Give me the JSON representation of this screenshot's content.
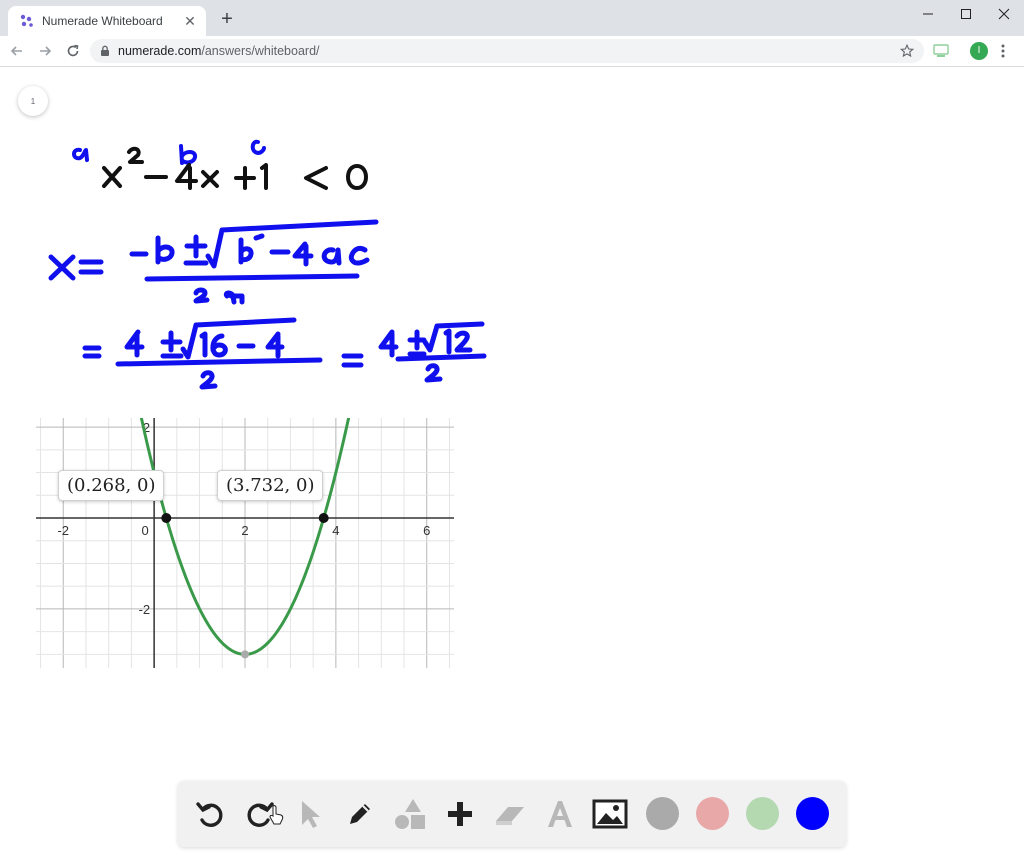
{
  "browser": {
    "tab_title": "Numerade Whiteboard",
    "url_host": "numerade.com",
    "url_path": "/answers/whiteboard/",
    "profile_initial": "I"
  },
  "whiteboard": {
    "page_number": "1"
  },
  "chart_data": {
    "type": "line",
    "series": [
      {
        "equation": "y = x^2 - 4x + 1"
      }
    ],
    "xlim": [
      -2.6,
      6.6
    ],
    "ylim": [
      -3.3,
      2.2
    ],
    "x_ticks": [
      "-2",
      "0",
      "2",
      "4",
      "6"
    ],
    "y_ticks": [
      "2",
      "-2"
    ],
    "grid": true,
    "points": [
      {
        "x": 0.268,
        "y": 0,
        "label": "(0.268, 0)"
      },
      {
        "x": 3.732,
        "y": 0,
        "label": "(3.732, 0)"
      },
      {
        "x": 2,
        "y": -3
      }
    ]
  },
  "colors": {
    "curve": "#3b9a4a",
    "ink_blue": "#1010ee",
    "ink_black": "#111111",
    "swatch_gray": "#aaaaaa",
    "swatch_pink": "#e8a8a8",
    "swatch_green": "#b4d8b0",
    "swatch_blue": "#0000ff"
  },
  "toolbar": {
    "tools": [
      "undo-icon",
      "redo-icon",
      "select-icon",
      "pen-icon",
      "shapes-icon",
      "add-icon",
      "eraser-icon",
      "text-icon",
      "image-icon"
    ]
  }
}
